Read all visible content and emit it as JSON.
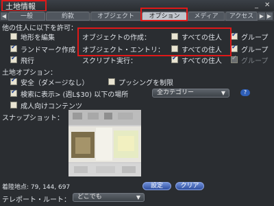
{
  "window": {
    "title": "土地情報",
    "minimize_glyph": "_",
    "close_glyph": "✕"
  },
  "tabs": [
    {
      "label": "一般"
    },
    {
      "label": "約款"
    },
    {
      "label": "オブジェクト"
    },
    {
      "label": "オプション"
    },
    {
      "label": "メディア"
    },
    {
      "label": "アクセス"
    }
  ],
  "tab_scroll": {
    "left_glyph": "◀",
    "right_glyph": "▶"
  },
  "permissions": {
    "heading": "他の住人に以下を許可：",
    "left_options": [
      {
        "label": "地形を編集",
        "checked": false
      },
      {
        "label": "ランドマーク作成",
        "checked": true
      },
      {
        "label": "飛行",
        "checked": true
      }
    ],
    "rows": [
      {
        "label": "オブジェクトの作成：",
        "everyone": "すべての住人",
        "everyone_checked": false,
        "group": "グループ",
        "group_checked": true,
        "group_dim": false
      },
      {
        "label": "オブジェクト・エントリ：",
        "everyone": "すべての住人",
        "everyone_checked": false,
        "group": "グループ",
        "group_checked": true,
        "group_dim": false
      },
      {
        "label": "スクリプト実行：",
        "everyone": "すべての住人",
        "everyone_checked": true,
        "group": "グループ",
        "group_checked": true,
        "group_dim": true
      }
    ]
  },
  "land_options": {
    "heading": "土地オプション：",
    "safe": {
      "label": "安全（ダメージなし）",
      "checked": true
    },
    "push": {
      "label": "プッシングを制限",
      "checked": false
    },
    "search": {
      "label": "検索に表示> (週L$30) 以下の場所",
      "checked": true
    },
    "category": "全カテゴリー",
    "category_arrow": "▼",
    "help": "?",
    "mature": {
      "label": "成人向けコンテンツ",
      "checked": false
    }
  },
  "snapshot": {
    "label": "スナップショット："
  },
  "landing": {
    "label": "着陸地点: 79, 144, 697",
    "set_button": "設定",
    "clear_button": "クリア"
  },
  "teleport": {
    "label": "テレポート・ルート：",
    "value": "どこでも",
    "arrow": "▼"
  },
  "colors": {
    "highlight": "#e01818",
    "button": "#3a5bb0",
    "panel": "#2a2d31"
  }
}
